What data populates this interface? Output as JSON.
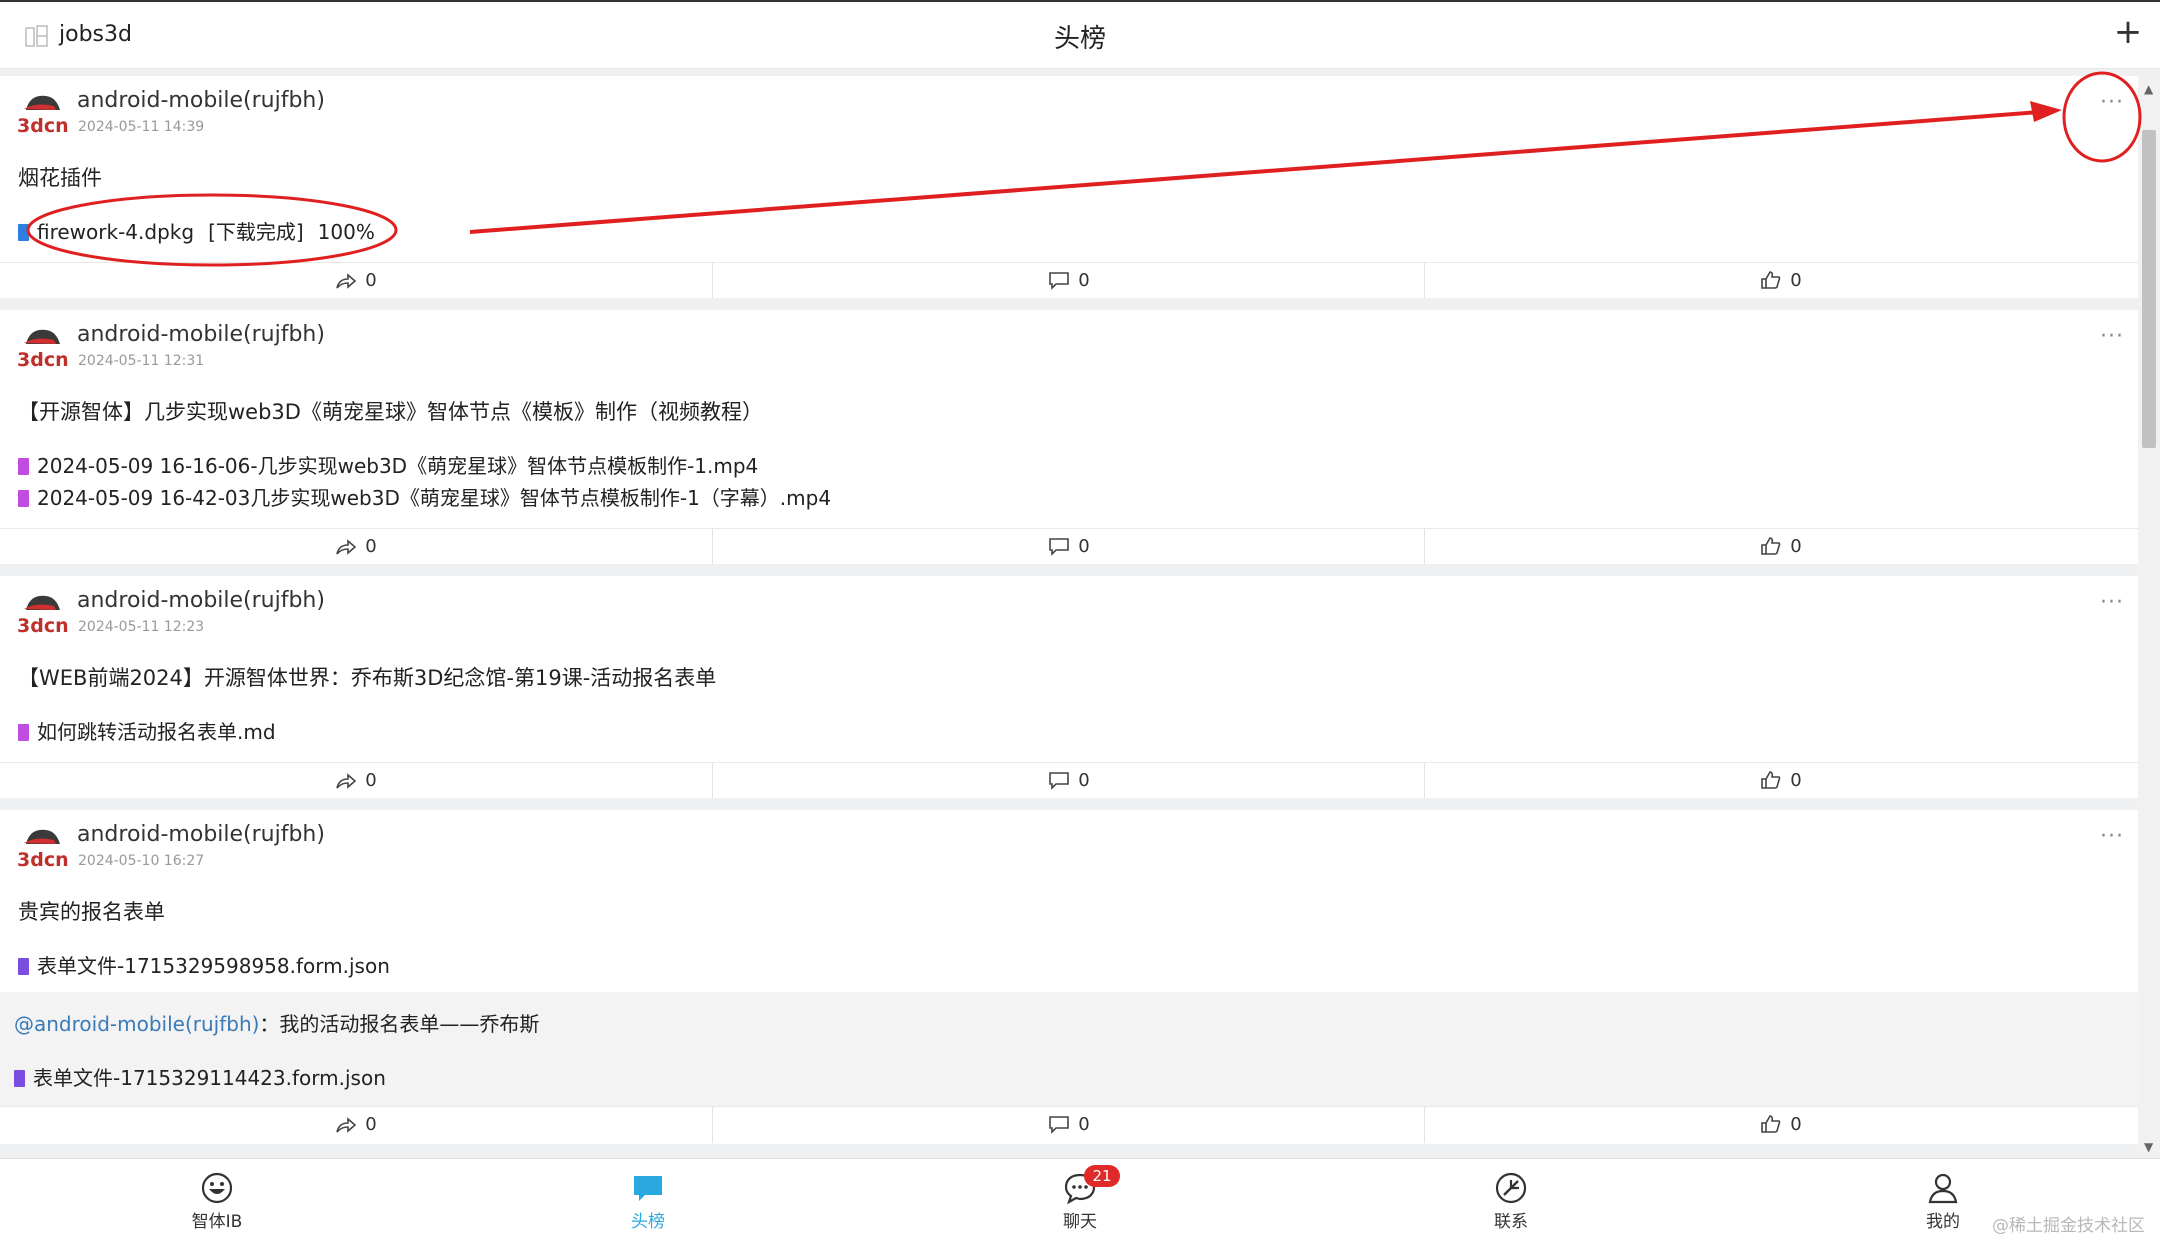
{
  "header": {
    "username": "jobs3d",
    "title": "头榜",
    "add_icon": "plus-icon"
  },
  "posts": [
    {
      "author": "android-mobile(rujfbh)",
      "avatar_text": "3dcn",
      "time": "2024-05-11 14:39",
      "content": "烟花插件",
      "files": [
        {
          "name": "firework-4.dpkg",
          "status": "[下载完成]",
          "percent": "100%",
          "color": "#2f7fe0",
          "progress": 1.0
        }
      ],
      "actions": {
        "share": "0",
        "comment": "0",
        "like": "0"
      }
    },
    {
      "author": "android-mobile(rujfbh)",
      "avatar_text": "3dcn",
      "time": "2024-05-11 12:31",
      "content": "【开源智体】几步实现web3D《萌宠星球》智体节点《模板》制作（视频教程）",
      "files": [
        {
          "name": "2024-05-09 16-16-06-几步实现web3D《萌宠星球》智体节点模板制作-1.mp4",
          "color": "#c04de0"
        },
        {
          "name": "2024-05-09 16-42-03几步实现web3D《萌宠星球》智体节点模板制作-1（字幕）.mp4",
          "color": "#c04de0"
        }
      ],
      "actions": {
        "share": "0",
        "comment": "0",
        "like": "0"
      }
    },
    {
      "author": "android-mobile(rujfbh)",
      "avatar_text": "3dcn",
      "time": "2024-05-11 12:23",
      "content": "【WEB前端2024】开源智体世界：乔布斯3D纪念馆-第19课-活动报名表单",
      "files": [
        {
          "name": "如何跳转活动报名表单.md",
          "color": "#c04de0"
        }
      ],
      "actions": {
        "share": "0",
        "comment": "0",
        "like": "0"
      }
    },
    {
      "author": "android-mobile(rujfbh)",
      "avatar_text": "3dcn",
      "time": "2024-05-10 16:27",
      "content": "贵宾的报名表单",
      "files": [
        {
          "name": "表单文件-1715329598958.form.json",
          "color": "#7a4de0"
        }
      ],
      "quote": {
        "mention": "@android-mobile(rujfbh)",
        "text": "：我的活动报名表单——乔布斯",
        "file": {
          "name": "表单文件-1715329114423.form.json",
          "color": "#7a4de0"
        }
      },
      "actions": {
        "share": "0",
        "comment": "0",
        "like": "0"
      }
    }
  ],
  "more_icon": "ellipsis-icon",
  "bottom_nav": [
    {
      "label": "智体IB",
      "icon": "smiley-icon"
    },
    {
      "label": "头榜",
      "icon": "chat-bubble-icon",
      "active": true
    },
    {
      "label": "聊天",
      "icon": "chat-icon",
      "badge": "21"
    },
    {
      "label": "联系",
      "icon": "compass-icon"
    },
    {
      "label": "我的",
      "icon": "user-icon"
    }
  ],
  "watermark": "@稀土掘金技术社区",
  "colors": {
    "accent": "#2aa8e0",
    "annotation": "#e02020",
    "badge": "#e02a2a",
    "mention": "#3a7ab8"
  }
}
